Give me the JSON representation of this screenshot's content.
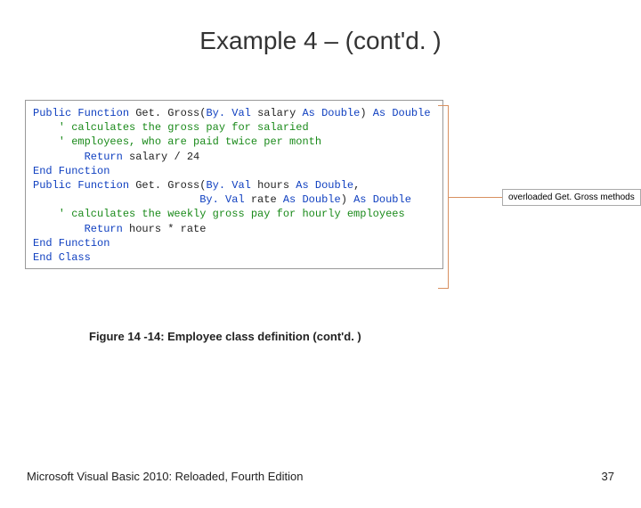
{
  "title": "Example 4 – (cont'd. )",
  "code": {
    "l1_a": "Public",
    "l1_b": " Function",
    "l1_c": " Get. Gross(",
    "l1_d": "By. Val",
    "l1_e": " salary ",
    "l1_f": "As",
    "l1_g": " Double",
    "l1_h": ") ",
    "l1_i": "As",
    "l1_j": " Double",
    "l2": "    ' calculates the gross pay for salaried",
    "l3": "    ' employees, who are paid twice per month",
    "l4": "",
    "l5_a": "        Return",
    "l5_b": " salary / 24",
    "l6_a": "End",
    "l6_b": " Function",
    "l7": "",
    "l8_a": "Public",
    "l8_b": " Function",
    "l8_c": " Get. Gross(",
    "l8_d": "By. Val",
    "l8_e": " hours ",
    "l8_f": "As",
    "l8_g": " Double",
    "l8_h": ",",
    "l9_a": "                          By. Val",
    "l9_b": " rate ",
    "l9_c": "As",
    "l9_d": " Double",
    "l9_e": ") ",
    "l9_f": "As",
    "l9_g": " Double",
    "l10": "    ' calculates the weekly gross pay for hourly employees",
    "l11": "",
    "l12_a": "        Return",
    "l12_b": " hours * rate",
    "l13_a": "End",
    "l13_b": " Function",
    "l14_a": "End",
    "l14_b": " Class"
  },
  "callout": "overloaded Get. Gross methods",
  "caption": "Figure 14 -14: Employee class definition (cont'd. )",
  "footer_left": "Microsoft Visual Basic 2010: Reloaded, Fourth Edition",
  "footer_right": "37"
}
